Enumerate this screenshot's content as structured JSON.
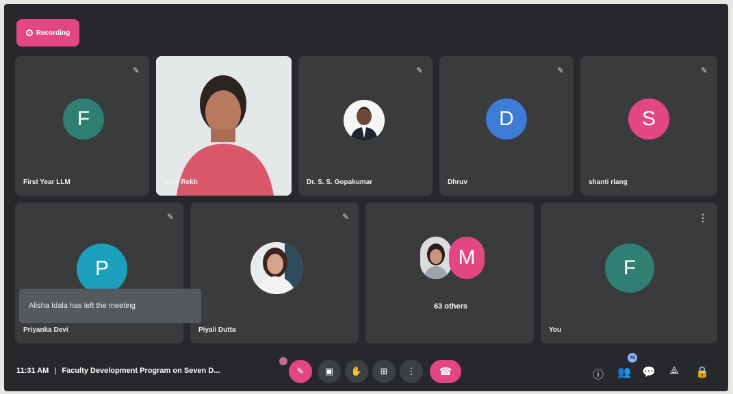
{
  "recording": {
    "label": "Recording",
    "color": "#e2487f"
  },
  "tiles": [
    {
      "name": "First Year LLM",
      "avatar": "F",
      "avatar_color": "#2f7f73",
      "mic": "muted"
    },
    {
      "name": "Sree Rekh",
      "video": true
    },
    {
      "name": "Dr. S. S. Gopakumar",
      "photo": true,
      "mic": "muted"
    },
    {
      "name": "Dhruv",
      "avatar": "D",
      "avatar_color": "#3e7bd6",
      "mic": "muted"
    },
    {
      "name": "shanti rlang",
      "avatar": "S",
      "avatar_color": "#e2487f",
      "mic": "muted"
    },
    {
      "name": "Priyanka Devi",
      "avatar": "P",
      "avatar_color": "#1aa0bd",
      "mic": "muted"
    },
    {
      "name": "Piyali Dutta",
      "photo": true,
      "mic": "muted"
    },
    {
      "name": "",
      "others_label": "63 others",
      "avatar": "M",
      "avatar_color": "#e2487f"
    },
    {
      "name": "You",
      "avatar": "F",
      "avatar_color": "#2f7f73",
      "mic": "options"
    }
  ],
  "toast": {
    "text": "Alisha Idala has left the meeting"
  },
  "bottom_bar": {
    "time": "11:31 AM",
    "separator": "|",
    "meeting_title": "Faculty Development Program on Seven D..."
  },
  "participants_count": "70",
  "colors": {
    "background": "#26282b",
    "tile": "#3a3b3d",
    "accent": "#e2487f"
  }
}
